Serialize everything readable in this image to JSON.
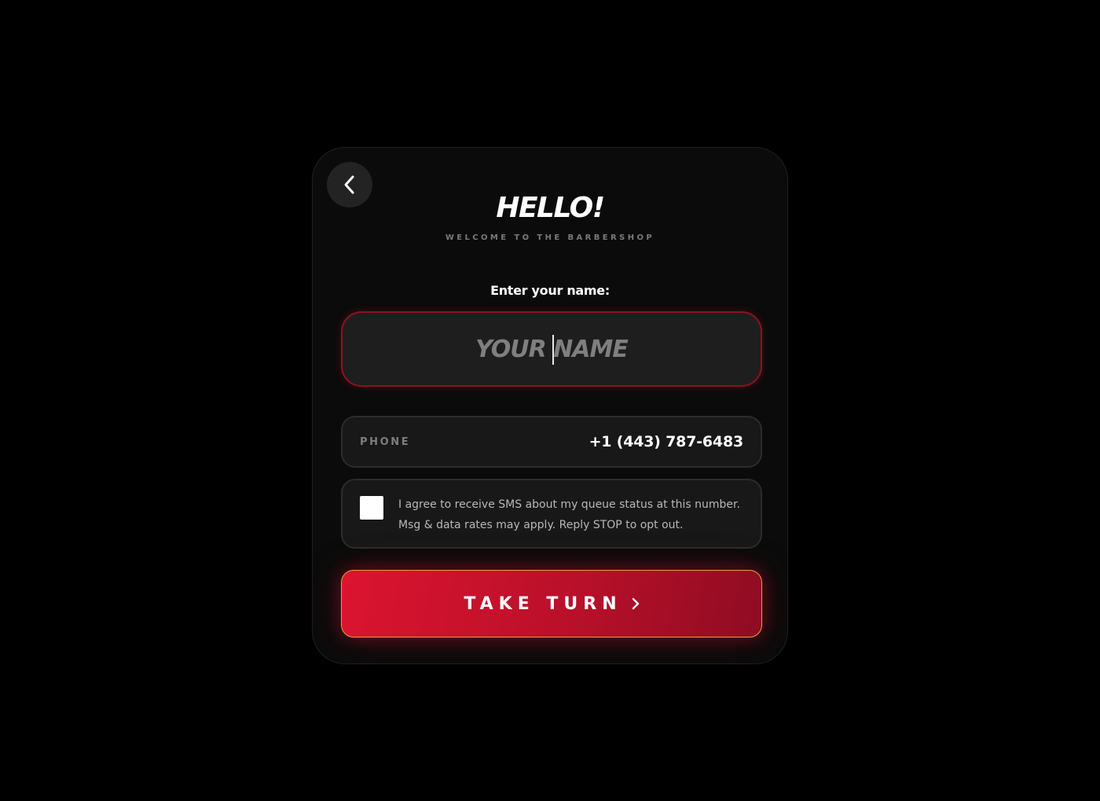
{
  "header": {
    "back_icon": "chevron-left-icon",
    "title": "HELLO!",
    "subtitle": "WELCOME TO THE BARBERSHOP"
  },
  "name_form": {
    "label": "Enter your name:",
    "value": "",
    "placeholder": "YOUR NAME"
  },
  "phone": {
    "label": "PHONE",
    "value": "+1 (443) 787-6483"
  },
  "consent": {
    "checked": false,
    "line1": "I agree to receive SMS about my queue status at this number.",
    "line2": "Msg & data rates may apply. Reply STOP to opt out."
  },
  "submit": {
    "label": "TAKE TURN",
    "icon": "chevron-right-icon"
  },
  "colors": {
    "background": "#000000",
    "card": "#0b0b0b",
    "accent_red": "#dc1430",
    "button_border": "#e0a23a"
  }
}
